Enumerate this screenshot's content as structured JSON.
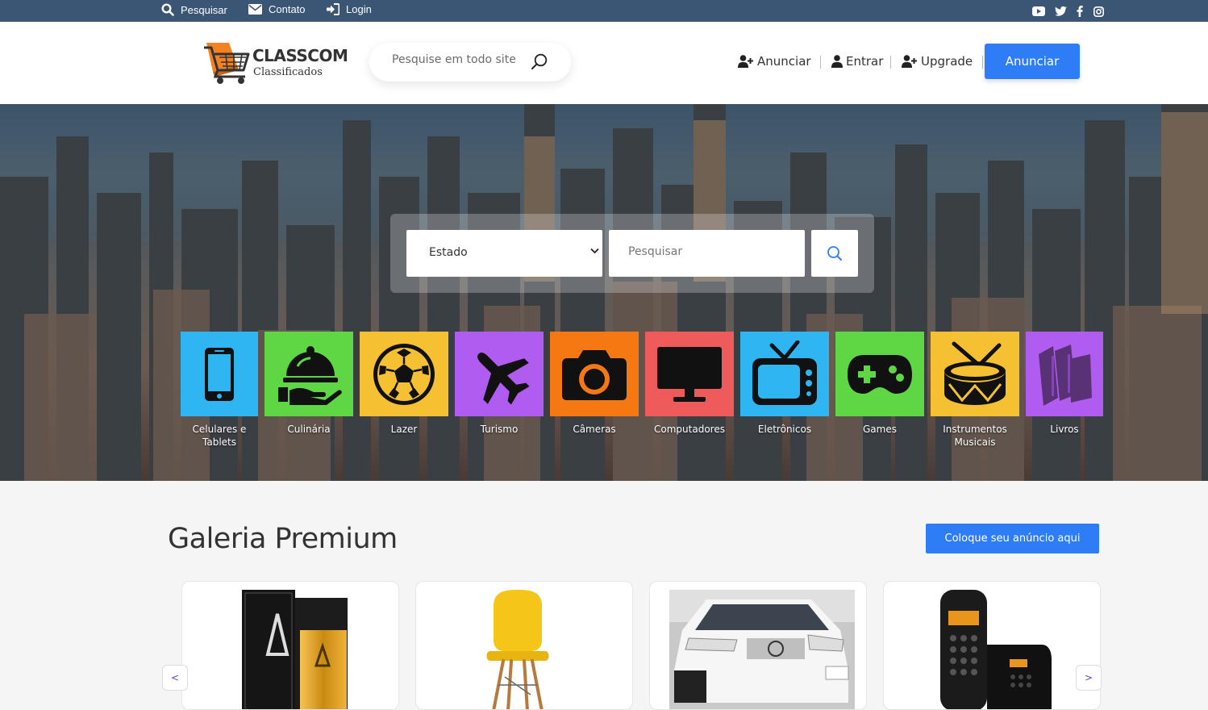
{
  "topbar": {
    "search_label": "Pesquisar",
    "contact_label": "Contato",
    "login_label": "Login",
    "social": [
      "youtube-icon",
      "twitter-icon",
      "facebook-icon",
      "instagram-icon"
    ]
  },
  "header": {
    "logo_title": "CLASSCOM",
    "logo_subtitle": "Classificados",
    "search_placeholder": "Pesquise em todo site",
    "nav": {
      "anunciar": "Anunciar",
      "entrar": "Entrar",
      "upgrade": "Upgrade"
    },
    "cta": "Anunciar"
  },
  "hero": {
    "estado_selected": "Estado",
    "search_placeholder": "Pesquisar",
    "categories": [
      {
        "label": "Celulares e Tablets",
        "color": "#2fb5f2",
        "icon": "smartphone-icon"
      },
      {
        "label": "Culinária",
        "color": "#5fd644",
        "icon": "food-tray-icon"
      },
      {
        "label": "Lazer",
        "color": "#f5c132",
        "icon": "soccer-ball-icon"
      },
      {
        "label": "Turismo",
        "color": "#b05cf0",
        "icon": "airplane-icon"
      },
      {
        "label": "Câmeras",
        "color": "#f57813",
        "icon": "camera-icon"
      },
      {
        "label": "Computadores",
        "color": "#ef5b5b",
        "icon": "monitor-icon"
      },
      {
        "label": "Eletrônicos",
        "color": "#2fb5f2",
        "icon": "tv-icon"
      },
      {
        "label": "Games",
        "color": "#5fd644",
        "icon": "gamepad-icon"
      },
      {
        "label": "Instrumentos Musicais",
        "color": "#f5c132",
        "icon": "drum-icon"
      },
      {
        "label": "Livros",
        "color": "#b05cf0",
        "icon": "books-icon"
      }
    ]
  },
  "galeria": {
    "title": "Galeria Premium",
    "cta": "Coloque seu anúncio aqui",
    "prev": "<",
    "next": ">",
    "cards": [
      {
        "image": "perfume-image"
      },
      {
        "image": "yellow-chair-image"
      },
      {
        "image": "white-suv-image"
      },
      {
        "image": "cordless-phone-image"
      }
    ]
  },
  "colors": {
    "topbar_bg": "#3b5575",
    "primary_blue": "#2f7df6",
    "logo_orange": "#f58220"
  }
}
